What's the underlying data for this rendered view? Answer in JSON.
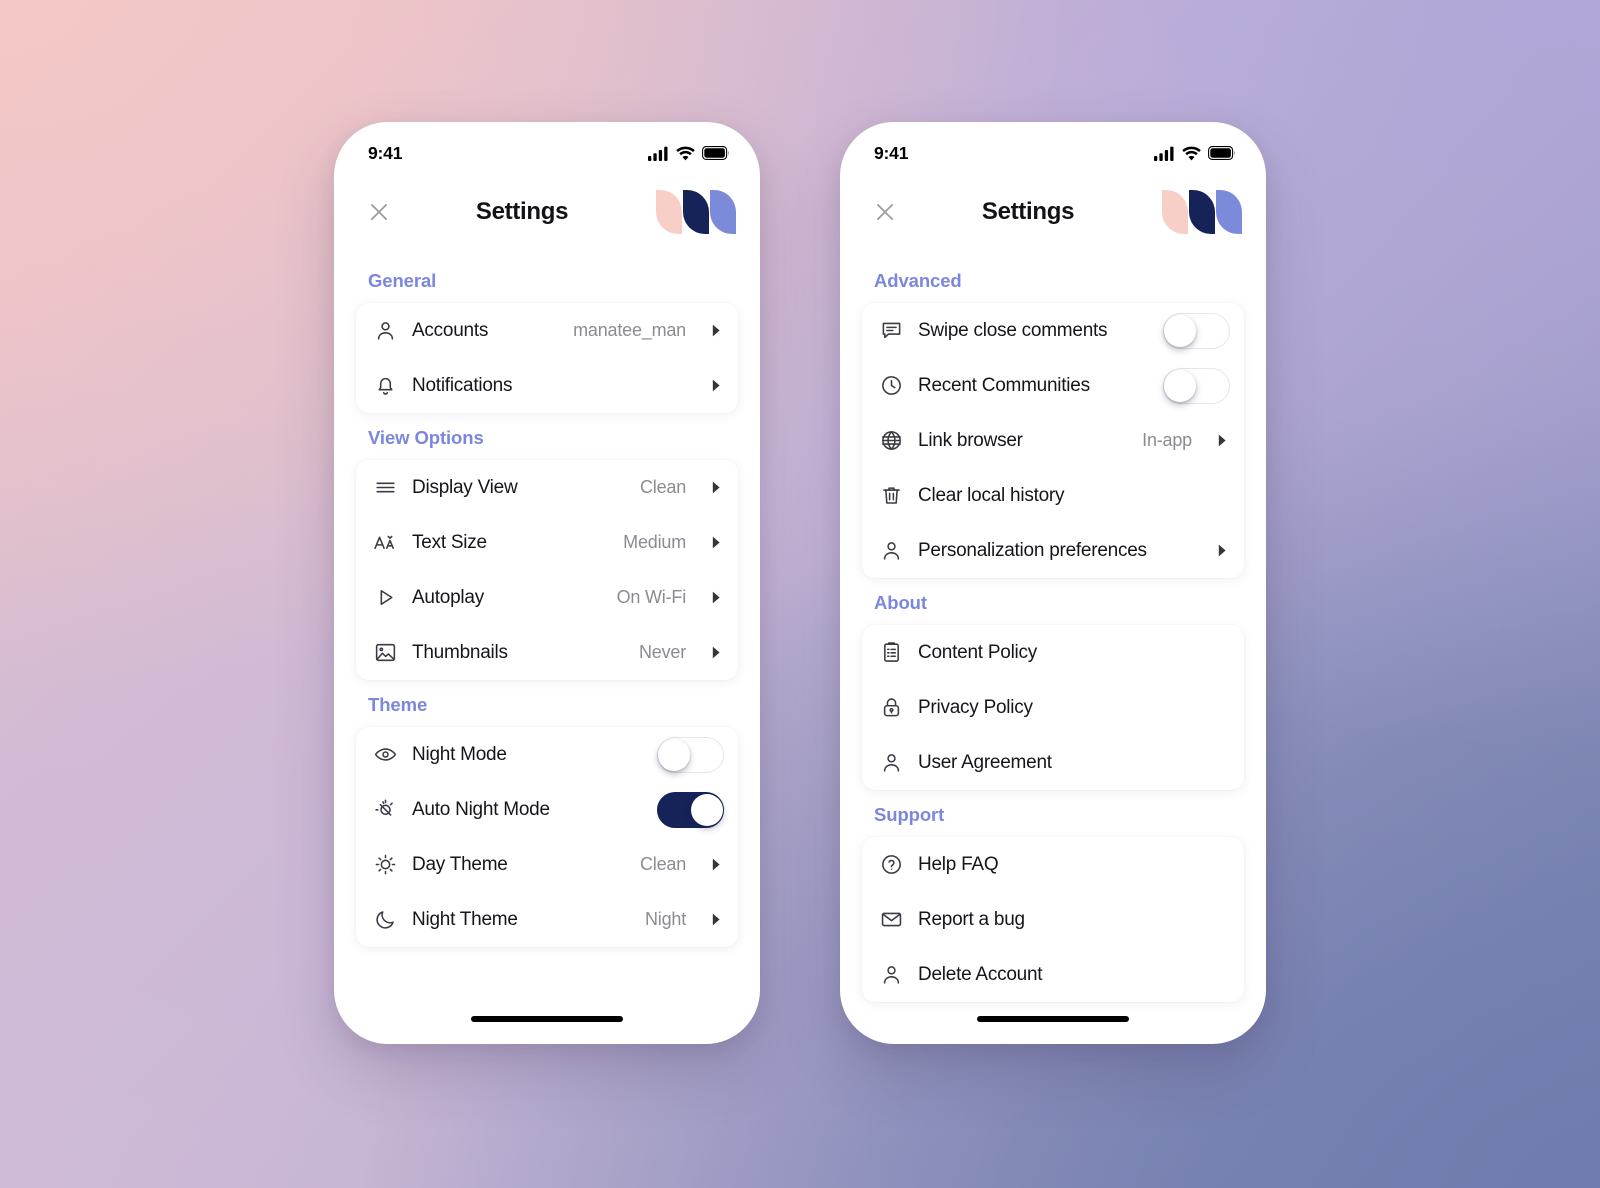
{
  "background": {
    "corner_top_left": "#f0c6ca",
    "corner_top_right": "#aca3d2",
    "corner_bottom_left": "#cfbcd5",
    "corner_bottom_right": "#757fab"
  },
  "theme_colors": {
    "section_header": "#7b87dd",
    "toggle_on": "#152359",
    "label": "#15151c",
    "value": "#8b8b93",
    "logo_pink": "#f7cfc6",
    "logo_navy": "#152359",
    "logo_blue": "#7b8ad9"
  },
  "status_bar": {
    "time": "9:41",
    "signal_icon": "cellular-signal-icon",
    "wifi_icon": "wifi-icon",
    "battery_icon": "battery-icon"
  },
  "header": {
    "close_icon": "close-icon",
    "title": "Settings",
    "logo_name": "app-logo"
  },
  "phones": [
    {
      "id": "phone-left",
      "sections": [
        {
          "title": "General",
          "rows": [
            {
              "icon": "person-icon",
              "label": "Accounts",
              "value": "manatee_man",
              "chevron": true,
              "control": "none"
            },
            {
              "icon": "bell-icon",
              "label": "Notifications",
              "value": "",
              "chevron": true,
              "control": "none"
            }
          ]
        },
        {
          "title": "View Options",
          "rows": [
            {
              "icon": "list-lines-icon",
              "label": "Display View",
              "value": "Clean",
              "chevron": true,
              "control": "none"
            },
            {
              "icon": "text-size-icon",
              "label": "Text Size",
              "value": "Medium",
              "chevron": true,
              "control": "none"
            },
            {
              "icon": "play-icon",
              "label": "Autoplay",
              "value": "On Wi-Fi",
              "chevron": true,
              "control": "none"
            },
            {
              "icon": "image-icon",
              "label": "Thumbnails",
              "value": "Never",
              "chevron": true,
              "control": "none"
            }
          ]
        },
        {
          "title": "Theme",
          "rows": [
            {
              "icon": "eye-icon",
              "label": "Night Mode",
              "value": "",
              "chevron": false,
              "control": "toggle",
              "toggle_on": false
            },
            {
              "icon": "auto-night-icon",
              "label": "Auto Night Mode",
              "value": "",
              "chevron": false,
              "control": "toggle",
              "toggle_on": true
            },
            {
              "icon": "sun-icon",
              "label": "Day Theme",
              "value": "Clean",
              "chevron": true,
              "control": "none"
            },
            {
              "icon": "moon-icon",
              "label": "Night Theme",
              "value": "Night",
              "chevron": true,
              "control": "none"
            }
          ]
        }
      ]
    },
    {
      "id": "phone-right",
      "sections": [
        {
          "title": "Advanced",
          "rows": [
            {
              "icon": "comment-icon",
              "label": "Swipe close comments",
              "value": "",
              "chevron": false,
              "control": "toggle",
              "toggle_on": false
            },
            {
              "icon": "clock-icon",
              "label": "Recent Communities",
              "value": "",
              "chevron": false,
              "control": "toggle",
              "toggle_on": false
            },
            {
              "icon": "globe-icon",
              "label": "Link browser",
              "value": "In-app",
              "chevron": true,
              "control": "none"
            },
            {
              "icon": "trash-icon",
              "label": "Clear local history",
              "value": "",
              "chevron": false,
              "control": "none"
            },
            {
              "icon": "person-icon",
              "label": "Personalization preferences",
              "value": "",
              "chevron": true,
              "control": "none"
            }
          ]
        },
        {
          "title": "About",
          "rows": [
            {
              "icon": "clipboard-icon",
              "label": "Content Policy",
              "value": "",
              "chevron": false,
              "control": "none"
            },
            {
              "icon": "lock-icon",
              "label": "Privacy Policy",
              "value": "",
              "chevron": false,
              "control": "none"
            },
            {
              "icon": "person-icon",
              "label": "User Agreement",
              "value": "",
              "chevron": false,
              "control": "none"
            }
          ]
        },
        {
          "title": "Support",
          "rows": [
            {
              "icon": "question-icon",
              "label": "Help FAQ",
              "value": "",
              "chevron": false,
              "control": "none"
            },
            {
              "icon": "envelope-icon",
              "label": "Report a bug",
              "value": "",
              "chevron": false,
              "control": "none"
            },
            {
              "icon": "person-icon",
              "label": "Delete Account",
              "value": "",
              "chevron": false,
              "control": "none"
            }
          ]
        }
      ]
    }
  ]
}
